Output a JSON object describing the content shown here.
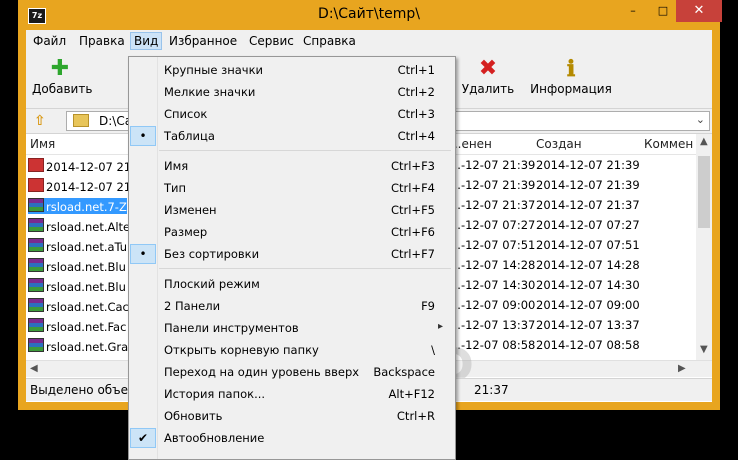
{
  "window": {
    "title": "D:\\Сайт\\temp\\",
    "app_icon": "7z",
    "minimize": "–",
    "maximize": "□",
    "close": "✕"
  },
  "menubar": {
    "items": [
      "Файл",
      "Правка",
      "Вид",
      "Избранное",
      "Сервис",
      "Справка"
    ],
    "active": "Вид"
  },
  "toolbar": {
    "add": "Добавить",
    "delete": "Удалить",
    "info": "Информация"
  },
  "address": {
    "path": "D:\\Сайт"
  },
  "columns": {
    "name": "Имя",
    "modified": "...енен",
    "created": "Создан",
    "comment": "Коммен"
  },
  "rows": [
    {
      "name": "2014-12-07 21",
      "modified": "...-12-07 21:39",
      "created": "2014-12-07 21:39",
      "icon": "png",
      "selected": false
    },
    {
      "name": "2014-12-07 21",
      "modified": "...-12-07 21:39",
      "created": "2014-12-07 21:39",
      "icon": "png",
      "selected": false
    },
    {
      "name": "rsload.net.7-Z",
      "modified": "...-12-07 21:37",
      "created": "2014-12-07 21:37",
      "icon": "rar",
      "selected": true
    },
    {
      "name": "rsload.net.Alte",
      "modified": "...-12-07 07:27",
      "created": "2014-12-07 07:27",
      "icon": "rar",
      "selected": false
    },
    {
      "name": "rsload.net.aTu",
      "modified": "...-12-07 07:51",
      "created": "2014-12-07 07:51",
      "icon": "rar",
      "selected": false
    },
    {
      "name": "rsload.net.Blu",
      "modified": "...-12-07 14:28",
      "created": "2014-12-07 14:28",
      "icon": "rar",
      "selected": false
    },
    {
      "name": "rsload.net.Blu",
      "modified": "...-12-07 14:30",
      "created": "2014-12-07 14:30",
      "icon": "rar",
      "selected": false
    },
    {
      "name": "rsload.net.Cac",
      "modified": "...-12-07 09:00",
      "created": "2014-12-07 09:00",
      "icon": "rar",
      "selected": false
    },
    {
      "name": "rsload.net.Fac",
      "modified": "...-12-07 13:37",
      "created": "2014-12-07 13:37",
      "icon": "rar",
      "selected": false
    },
    {
      "name": "rsload.net.Gra",
      "modified": "...-12-07 08:58",
      "created": "2014-12-07 08:58",
      "icon": "rar",
      "selected": false
    }
  ],
  "status": {
    "left": "Выделено объект",
    "right": "21:37"
  },
  "watermark": "RSLOAD",
  "view_menu": [
    {
      "label": "Крупные значки",
      "shortcut": "Ctrl+1",
      "mark": ""
    },
    {
      "label": "Мелкие значки",
      "shortcut": "Ctrl+2",
      "mark": ""
    },
    {
      "label": "Список",
      "shortcut": "Ctrl+3",
      "mark": ""
    },
    {
      "label": "Таблица",
      "shortcut": "Ctrl+4",
      "mark": "•"
    },
    {
      "sep": true
    },
    {
      "label": "Имя",
      "shortcut": "Ctrl+F3",
      "mark": ""
    },
    {
      "label": "Тип",
      "shortcut": "Ctrl+F4",
      "mark": ""
    },
    {
      "label": "Изменен",
      "shortcut": "Ctrl+F5",
      "mark": ""
    },
    {
      "label": "Размер",
      "shortcut": "Ctrl+F6",
      "mark": ""
    },
    {
      "label": "Без сортировки",
      "shortcut": "Ctrl+F7",
      "mark": "•"
    },
    {
      "sep": true
    },
    {
      "label": "Плоский режим",
      "shortcut": "",
      "mark": ""
    },
    {
      "label": "2 Панели",
      "shortcut": "F9",
      "mark": ""
    },
    {
      "label": "Панели инструментов",
      "shortcut": "",
      "mark": "",
      "submenu": true
    },
    {
      "label": "Открыть корневую папку",
      "shortcut": "\\",
      "mark": ""
    },
    {
      "label": "Переход на один уровень вверх",
      "shortcut": "Backspace",
      "mark": ""
    },
    {
      "label": "История папок...",
      "shortcut": "Alt+F12",
      "mark": ""
    },
    {
      "label": "Обновить",
      "shortcut": "Ctrl+R",
      "mark": ""
    },
    {
      "label": "Автообновление",
      "shortcut": "",
      "mark": "✔"
    }
  ],
  "colors": {
    "frame": "#e8a51f",
    "selection": "#3399ff",
    "close": "#c7413a"
  }
}
